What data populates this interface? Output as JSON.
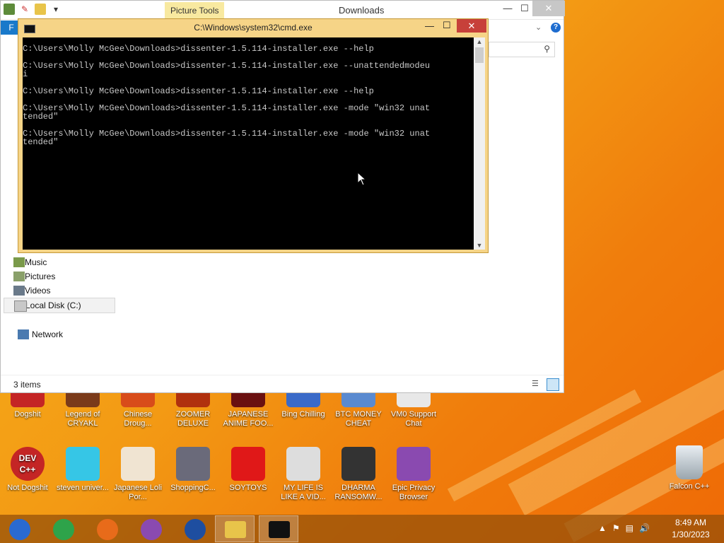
{
  "explorer": {
    "title": "Downloads",
    "context_tab": "Picture Tools",
    "file_tab": "F",
    "help_glyph": "?",
    "controls": {
      "minimize": "—",
      "maximize": "☐",
      "close": "✕"
    },
    "nav_items": [
      {
        "label": "Music",
        "icon": "music-folder-icon",
        "selected": false
      },
      {
        "label": "Pictures",
        "icon": "pictures-folder-icon",
        "selected": false
      },
      {
        "label": "Videos",
        "icon": "videos-folder-icon",
        "selected": false
      },
      {
        "label": "Local Disk (C:)",
        "icon": "drive-icon",
        "selected": true
      },
      {
        "label": "Network",
        "icon": "network-icon",
        "selected": false
      }
    ],
    "status": "3 items"
  },
  "cmd": {
    "title": "C:\\Windows\\system32\\cmd.exe",
    "controls": {
      "minimize": "—",
      "maximize": "☐",
      "close": "✕"
    },
    "lines": [
      "C:\\Users\\Molly McGee\\Downloads>dissenter-1.5.114-installer.exe --help",
      "",
      "C:\\Users\\Molly McGee\\Downloads>dissenter-1.5.114-installer.exe --unattendedmodeu",
      "i",
      "",
      "C:\\Users\\Molly McGee\\Downloads>dissenter-1.5.114-installer.exe --help",
      "",
      "C:\\Users\\Molly McGee\\Downloads>dissenter-1.5.114-installer.exe -mode \"win32 unat",
      "tended\"",
      "",
      "C:\\Users\\Molly McGee\\Downloads>dissenter-1.5.114-installer.exe -mode \"win32 unat",
      "tended\""
    ]
  },
  "desktop_icons_row1": [
    {
      "label": "Dogshit",
      "icon": "dev-cpp-icon",
      "color": "#c42525"
    },
    {
      "label": "Legend of CRYAKL",
      "icon": "game-icon",
      "color": "#7a3a1a"
    },
    {
      "label": "Chinese Droug...",
      "icon": "chinese-icon",
      "color": "#d84c1a"
    },
    {
      "label": "ZOOMER DELUXE",
      "icon": "zoomer-icon",
      "color": "#b0300e"
    },
    {
      "label": "JAPANESE ANIME FOO...",
      "icon": "anime-icon",
      "color": "#6a1010"
    },
    {
      "label": "Bing Chilling",
      "icon": "bing-icon",
      "color": "#3a6ac8"
    },
    {
      "label": "BTC MONEY CHEAT",
      "icon": "btc-icon",
      "color": "#5a8ad0"
    },
    {
      "label": "VM0 Support Chat",
      "icon": "chat-icon",
      "color": "#e8e8e8"
    }
  ],
  "desktop_icons_row2": [
    {
      "label": "Not Dogshit",
      "icon": "dev-cpp-icon",
      "color": "#c42525",
      "badge": "DEV C++"
    },
    {
      "label": "steven univer...",
      "icon": "diamond-icon",
      "color": "#36c6e6"
    },
    {
      "label": "Japanese Loli Por...",
      "icon": "torii-icon",
      "color": "#f0e4d2"
    },
    {
      "label": "ShoppingC...",
      "icon": "flash-icon",
      "color": "#6a6a7a"
    },
    {
      "label": "SOYTOYS",
      "icon": "soytoys-icon",
      "color": "#e01818"
    },
    {
      "label": "MY LIFE IS LIKE A VID...",
      "icon": "gamepad-icon",
      "color": "#dddddd"
    },
    {
      "label": "DHARMA RANSOMW...",
      "icon": "skull-icon",
      "color": "#333333"
    },
    {
      "label": "Epic Privacy Browser",
      "icon": "epic-browser-icon",
      "color": "#8a4ab0"
    }
  ],
  "recycle": {
    "label": "Falcon C++",
    "icon": "recycle-bin-icon"
  },
  "taskbar": {
    "buttons": [
      {
        "name": "start-globe-icon",
        "color": "#2a6ad0"
      },
      {
        "name": "chrome-icon",
        "color": "#2ea34a"
      },
      {
        "name": "firefox-icon",
        "color": "#e86b1a"
      },
      {
        "name": "epic-browser-icon",
        "color": "#8a4ab0"
      },
      {
        "name": "obama-icon",
        "color": "#1e4ea0"
      },
      {
        "name": "file-explorer-icon",
        "color": "#e8c44a"
      },
      {
        "name": "cmd-icon",
        "color": "#111111"
      }
    ],
    "tray": [
      "▲",
      "⚑",
      "▤",
      "🔊"
    ],
    "time": "8:49 AM",
    "date": "1/30/2023"
  }
}
